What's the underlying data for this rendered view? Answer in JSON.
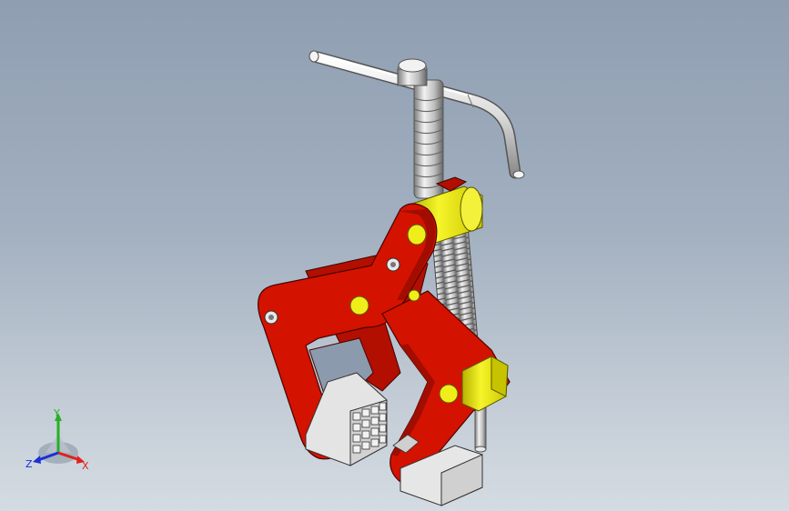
{
  "viewport": {
    "background_top": "#8f9eb1",
    "background_bottom": "#d4dbe2"
  },
  "model": {
    "parts": [
      "t-handle",
      "lead-screw",
      "screw-nut-collar",
      "front-jaw-arm",
      "rear-jaw-arm",
      "lower-jaw",
      "guide-block",
      "gripping-block-left",
      "gripping-block-right",
      "guide-rod"
    ],
    "colors": {
      "arm": "#d41200",
      "arm_dark": "#8d0a00",
      "arm_edge": "#4a0400",
      "nut": "#f0ee1a",
      "nut_dark": "#b8b500",
      "steel": "#e6e6e6",
      "steel_dark": "#9a9a9a",
      "block": "#ececec",
      "block_dark": "#b9b9b9"
    }
  },
  "triad": {
    "x_label": "X",
    "y_label": "Y",
    "z_label": "Z",
    "x_color": "#e0201a",
    "y_color": "#27b024",
    "z_color": "#1b2fd6"
  }
}
